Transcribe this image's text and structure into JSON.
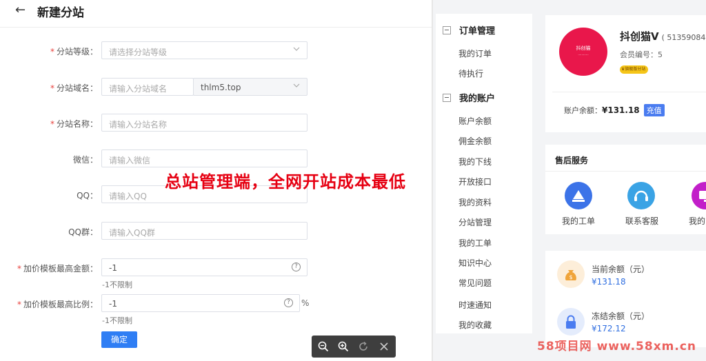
{
  "header": {
    "title": "新建分站"
  },
  "form": {
    "level_label": "分站等级：",
    "level_placeholder": "请选择分站等级",
    "domain_label": "分站域名：",
    "domain_placeholder": "请输入分站域名",
    "domain_suffix": "thlm5.top",
    "name_label": "分站名称：",
    "name_placeholder": "请输入分站名称",
    "wechat_label": "微信：",
    "wechat_placeholder": "请输入微信",
    "qq_label": "QQ：",
    "qq_placeholder": "请输入QQ",
    "qqgroup_label": "QQ群：",
    "qqgroup_placeholder": "请输入QQ群",
    "max_amount_label": "加价模板最高金额：",
    "max_amount_value": "-1",
    "max_amount_hint": "-1不限制",
    "max_ratio_label": "加价模板最高比例：",
    "max_ratio_value": "-1",
    "max_ratio_unit": "%",
    "max_ratio_hint": "-1不限制",
    "submit_label": "确定"
  },
  "promo_text": "总站管理端，全网开站成本最低",
  "menu": {
    "group1": "订单管理",
    "group1_items": [
      "我的订单",
      "待执行"
    ],
    "group2": "我的账户",
    "group2_items": [
      "账户余额",
      "佣金余额",
      "我的下线",
      "开放接口",
      "我的资料",
      "分站管理",
      "我的工单",
      "知识中心",
      "常见问题",
      "时速通知",
      "我的收藏"
    ]
  },
  "profile": {
    "logo_text": "抖创猫",
    "name": "抖创猫V",
    "id": "( 51359084",
    "member_no": "会员编号：5",
    "badge": "旗舰版分站",
    "balance_label": "账户余额：",
    "balance_value": "¥131.18",
    "charge_label": "充值"
  },
  "services": {
    "title": "售后服务",
    "items": [
      "我的工单",
      "联系客服",
      "我的"
    ]
  },
  "stats": {
    "current_label": "当前余额（元）",
    "current_value": "¥131.18",
    "frozen_label": "冻结余额（元）",
    "frozen_value": "¥172.12"
  },
  "watermark": "58项目网 www.58xm.cn",
  "colors": {
    "primary": "#2f7ef4",
    "required": "#e8413c",
    "promo": "#e60012",
    "logo": "#e9174b",
    "link_value": "#2f6ee0"
  }
}
